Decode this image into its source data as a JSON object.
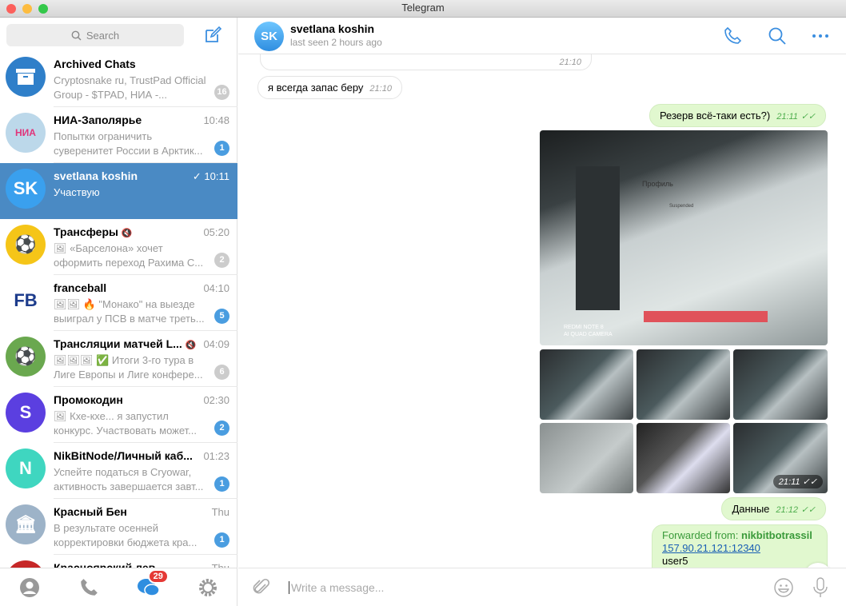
{
  "window": {
    "title": "Telegram"
  },
  "sidebar": {
    "search_placeholder": "Search",
    "chats": [
      {
        "name": "Archived Chats",
        "time": "",
        "preview": "Cryptosnake ru, TrustPad Official Group - $TPAD, НИА -...",
        "badge": "16",
        "muted": true,
        "avatar": "archive-icon",
        "color": "#2f7fc9"
      },
      {
        "name": "НИА-Заполярье",
        "time": "10:48",
        "preview": "Попытки ограничить суверенитет России в Арктик...",
        "badge": "1",
        "muted": false,
        "avatar": "НИА",
        "color": "#bcd8ea"
      },
      {
        "name": "svetlana koshin",
        "time": "10:11",
        "preview": "Участвую",
        "badge": "",
        "muted": false,
        "avatar": "SK",
        "color": "#3aa0ee",
        "selected": true,
        "read": true
      },
      {
        "name": "Трансферы",
        "time": "05:20",
        "preview": "🖼 «Барселона» хочет оформить переход Рахима С...",
        "badge": "2",
        "muted": true,
        "avatar": "⚽",
        "color": "#f5c518",
        "mute_icon": true
      },
      {
        "name": "franceball",
        "time": "04:10",
        "preview": "🖼🖼 🔥 \"Монако\" на выезде выиграл у ПСВ в матче треть...",
        "badge": "5",
        "muted": false,
        "avatar": "FB",
        "color": "#ffffff"
      },
      {
        "name": "Трансляции матчей L...",
        "time": "04:09",
        "preview": "🖼🖼🖼 ✅ Итоги 3-го тура в Лиге Европы и Лиге конфере...",
        "badge": "6",
        "muted": true,
        "avatar": "⚽",
        "color": "#6aa84f",
        "mute_icon": true
      },
      {
        "name": "Промокодин",
        "time": "02:30",
        "preview": "🖼 Кхе-кхе... я запустил конкурс. Участвовать может...",
        "badge": "2",
        "muted": false,
        "avatar": "S",
        "color": "#5b3fe0"
      },
      {
        "name": "NikBitNode/Личный каб...",
        "time": "01:23",
        "preview": "Успейте податься в Cryowar, активность завершается завт...",
        "badge": "1",
        "muted": false,
        "avatar": "N",
        "color": "#3fd6c0"
      },
      {
        "name": "Красный Бен",
        "time": "Thu",
        "preview": "В результате осенней корректировки бюджета кра...",
        "badge": "1",
        "muted": false,
        "avatar": "🏛",
        "color": "#9db3c8"
      },
      {
        "name": "Красноярский лев",
        "time": "Thu",
        "preview": "",
        "badge": "",
        "muted": false,
        "avatar": "",
        "color": "#c62828"
      }
    ],
    "bottom_tabs": [
      {
        "icon": "contacts-icon"
      },
      {
        "icon": "calls-icon"
      },
      {
        "icon": "chats-icon",
        "badge": "29"
      },
      {
        "icon": "settings-icon"
      }
    ]
  },
  "chat": {
    "name": "svetlana koshin",
    "initials": "SK",
    "status": "last seen 2 hours ago",
    "messages": {
      "m0": {
        "time": "21:10"
      },
      "m1": {
        "text": "я всегда запас беру",
        "time": "21:10"
      },
      "m2": {
        "text": "Резерв всё-таки есть?)",
        "time": "21:11"
      },
      "album": {
        "time": "21:11",
        "watermark1": "REDMI NOTE 8",
        "watermark2": "AI QUAD CAMERA",
        "screen_title": "Профиль",
        "screen_status": "Suspended"
      },
      "m3": {
        "text": "Данные",
        "time": "21:12"
      },
      "m4": {
        "forwarded_label": "Forwarded from:",
        "forwarded_from": "nikbitbotrassil",
        "link": "157.90.21.121:12340",
        "line2": "user5"
      }
    },
    "input_placeholder": "Write a message..."
  },
  "colors": {
    "accent": "#4a8ac4",
    "outgoing": "#e1f8cf",
    "badge": "#4a9de0"
  }
}
